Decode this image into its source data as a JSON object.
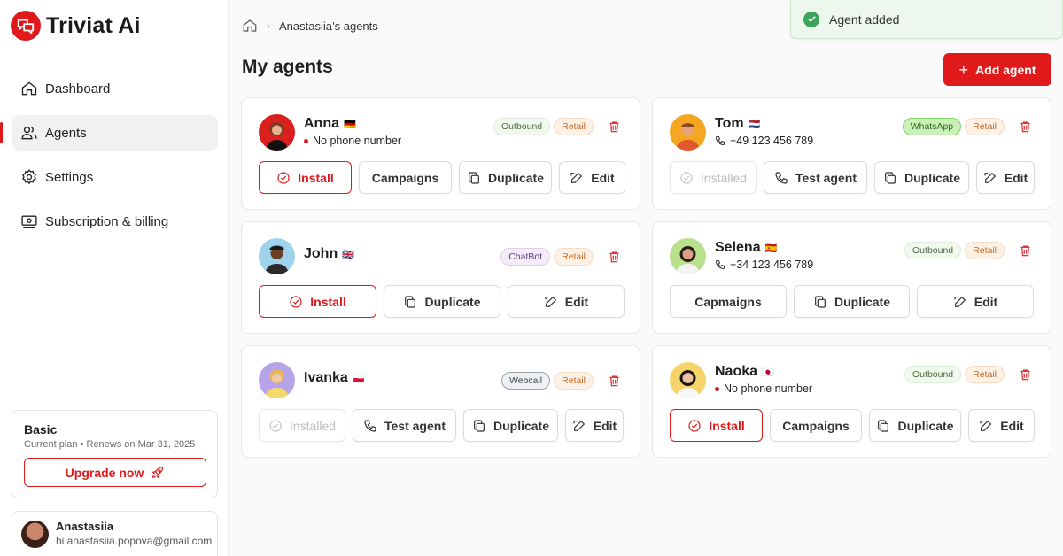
{
  "app": {
    "name": "Triviat Ai"
  },
  "sidebar": {
    "items": [
      {
        "label": "Dashboard",
        "icon": "home-icon"
      },
      {
        "label": "Agents",
        "icon": "users-icon",
        "active": true
      },
      {
        "label": "Settings",
        "icon": "gear-icon"
      },
      {
        "label": "Subscription & billing",
        "icon": "billing-icon"
      }
    ],
    "plan": {
      "name": "Basic",
      "details": "Current plan • Renews on Mar 31, 2025",
      "upgrade_label": "Upgrade now"
    },
    "user": {
      "name": "Anastasiia",
      "email": "hi.anastasiia.popova@gmail.com"
    }
  },
  "breadcrumb": {
    "current": "Anastasiia’s agents"
  },
  "page": {
    "title": "My agents",
    "add_label": "Add agent"
  },
  "toast": {
    "message": "Agent added"
  },
  "agents": [
    {
      "name": "Anna",
      "flag": "🇩🇪",
      "status": "No phone number",
      "tags": [
        "Outbound",
        "Retail"
      ],
      "actions": [
        "Install",
        "Campaigns",
        "Duplicate",
        "Edit"
      ]
    },
    {
      "name": "Tom",
      "flag": "🇳🇱",
      "status": "+49 123 456 789",
      "tags": [
        "WhatsApp",
        "Retail"
      ],
      "actions": [
        "Installed",
        "Test agent",
        "Duplicate",
        "Edit"
      ]
    },
    {
      "name": "John",
      "flag": "🇬🇧",
      "status": "",
      "tags": [
        "ChatBot",
        "Retail"
      ],
      "actions": [
        "Install",
        "Duplicate",
        "Edit"
      ]
    },
    {
      "name": "Selena",
      "flag": "🇪🇸",
      "status": "+34 123 456 789",
      "tags": [
        "Outbound",
        "Retail"
      ],
      "actions": [
        "Capmaigns",
        "Duplicate",
        "Edit"
      ]
    },
    {
      "name": "Ivanka",
      "flag": "🇵🇱",
      "status": "",
      "tags": [
        "Webcall",
        "Retail"
      ],
      "actions": [
        "Installed",
        "Test agent",
        "Duplicate",
        "Edit"
      ]
    },
    {
      "name": "Naoka",
      "flag": "🇯🇵",
      "status": "No phone number",
      "tags": [
        "Outbound",
        "Retail"
      ],
      "actions": [
        "Install",
        "Campaigns",
        "Duplicate",
        "Edit"
      ]
    }
  ],
  "colors": {
    "accent": "#e0191b",
    "success": "#3ba55c"
  }
}
